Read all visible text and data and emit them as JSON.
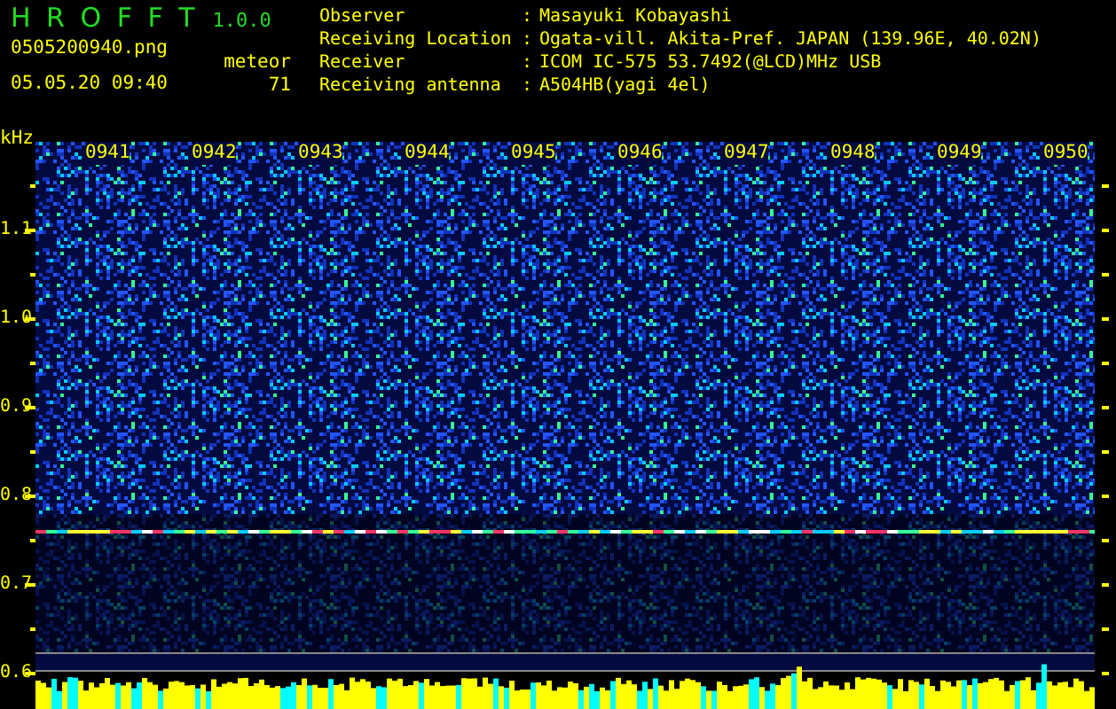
{
  "header": {
    "title": "H R O F F T",
    "version": "1.0.0",
    "filename": "0505200940.png",
    "datetime": "05.05.20 09:40",
    "meteor_label": "meteor",
    "meteor_count": "71"
  },
  "info": [
    {
      "label": "Observer",
      "separator": ":",
      "value": "Masayuki Kobayashi"
    },
    {
      "label": "Receiving Location",
      "separator": ":",
      "value": "Ogata-vill. Akita-Pref. JAPAN (139.96E, 40.02N)"
    },
    {
      "label": "Receiver",
      "separator": ":",
      "value": "ICOM IC-575 53.7492(@LCD)MHz USB"
    },
    {
      "label": "Receiving antenna",
      "separator": ":",
      "value": "A504HB(yagi 4el)"
    }
  ],
  "axis": {
    "unit": "kHz",
    "y_ticks": [
      "1.1",
      "1.0",
      "0.9",
      "0.8",
      "0.7",
      "0.6"
    ],
    "time_labels": [
      "0941",
      "0942",
      "0943",
      "0944",
      "0945",
      "0946",
      "0947",
      "0948",
      "0949",
      "0950"
    ]
  }
}
